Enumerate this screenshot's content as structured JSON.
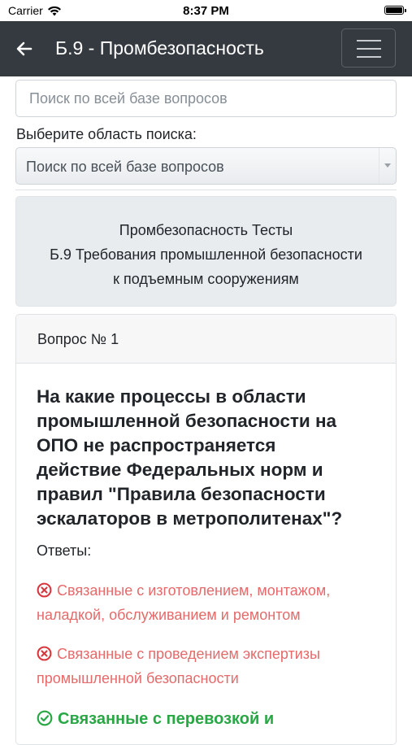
{
  "status_bar": {
    "carrier": "Carrier",
    "time": "8:37 PM"
  },
  "navbar": {
    "title": "Б.9 - Промбезопасность"
  },
  "search": {
    "placeholder": "Поиск по всей базе вопросов"
  },
  "scope": {
    "label": "Выберите область поиска:",
    "selected": "Поиск по всей базе вопросов"
  },
  "jumbotron": {
    "lines": [
      "Промбезопасность Тесты",
      "Б.9 Требования промышленной безопасности",
      "к подъемным сооружениям"
    ]
  },
  "question_card": {
    "header": "Вопрос № 1",
    "question_lines": [
      "На какие процессы в области",
      "промышленной безопасности на",
      "ОПО не распространяется",
      "действие Федеральных норм и",
      "правил \"Правила безопасности",
      "эскалаторов в метрополитенах\"?"
    ],
    "answers_label": "Ответы:",
    "answers": [
      {
        "lines": [
          "Связанные с изготовлением, монтажом,",
          "наладкой, обслуживанием и ремонтом"
        ],
        "correct": false
      },
      {
        "lines": [
          "Связанные с проведением экспертизы",
          "промышленной безопасности"
        ],
        "correct": false
      },
      {
        "lines": [
          "Связанные с перевозкой и"
        ],
        "correct": true
      }
    ]
  },
  "colors": {
    "navbar": "#343a40",
    "wrong": "#e56a6a",
    "right": "#28a745"
  },
  "icons": {
    "back": "arrow-left-icon",
    "menu": "hamburger-icon",
    "wrong": "x-circle-icon",
    "right": "check-circle-icon"
  }
}
